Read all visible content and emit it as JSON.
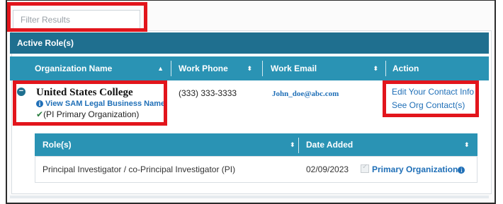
{
  "filter": {
    "placeholder": "Filter Results"
  },
  "panel": {
    "title": "Active Role(s)"
  },
  "table": {
    "headers": {
      "organization_name": "Organization Name",
      "work_phone": "Work Phone",
      "work_email": "Work Email",
      "action": "Action"
    },
    "row": {
      "org_name": "United States College",
      "sam_link": "View SAM Legal Business Name",
      "primary_note": "(PI Primary Organization)",
      "phone": "(333) 333-3333",
      "email": "John_doe@abc.com",
      "actions": [
        "Edit Your Contact Info",
        "See Org Contact(s)"
      ]
    }
  },
  "roles_table": {
    "headers": {
      "roles": "Role(s)",
      "date_added": "Date Added"
    },
    "rows": [
      {
        "role": "Principal Investigator / co-Principal Investigator (PI)",
        "date": "02/09/2023",
        "primary_label": "Primary Organization"
      }
    ]
  },
  "icons": {
    "collapse": "minus-circle-icon",
    "info": "info-circle-icon",
    "check": "check-icon",
    "sort": "sort-icon"
  },
  "colors": {
    "header_dark": "#1f6f8f",
    "header_light": "#2a93b4",
    "link": "#1f6fb7",
    "highlight": "#e2151c"
  }
}
